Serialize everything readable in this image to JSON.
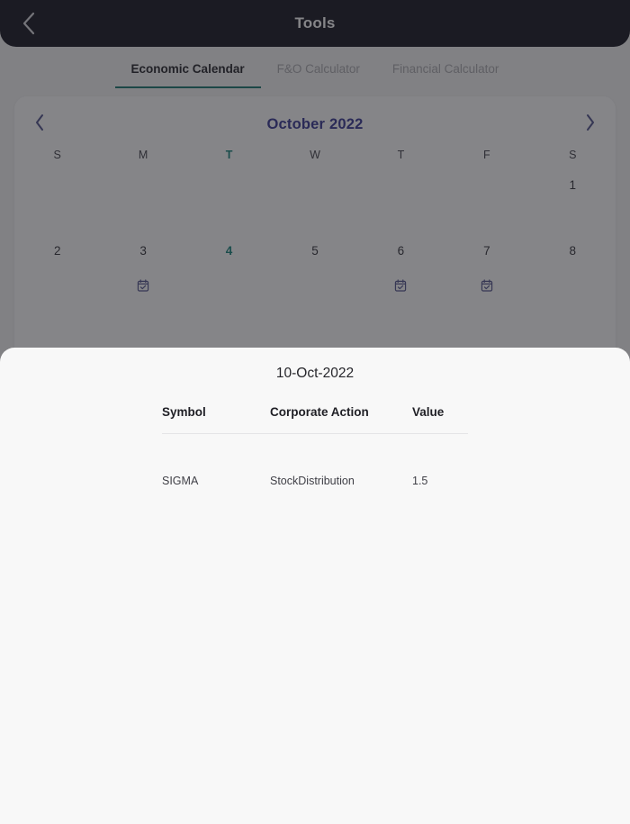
{
  "appbar": {
    "title": "Tools",
    "back_icon": "chevron-left-icon"
  },
  "tabs": [
    {
      "label": "Economic Calendar",
      "active": true
    },
    {
      "label": "F&O Calculator",
      "active": false
    },
    {
      "label": "Financial Calculator",
      "active": false
    }
  ],
  "calendar": {
    "month_title": "October 2022",
    "prev_icon": "chevron-left-icon",
    "next_icon": "chevron-right-icon",
    "weekday_headers": [
      {
        "label": "S",
        "today": false
      },
      {
        "label": "M",
        "today": false
      },
      {
        "label": "T",
        "today": true
      },
      {
        "label": "W",
        "today": false
      },
      {
        "label": "T",
        "today": false
      },
      {
        "label": "F",
        "today": false
      },
      {
        "label": "S",
        "today": false
      }
    ],
    "weeks": [
      [
        {
          "day": "",
          "today": false,
          "event": false
        },
        {
          "day": "",
          "today": false,
          "event": false
        },
        {
          "day": "",
          "today": false,
          "event": false
        },
        {
          "day": "",
          "today": false,
          "event": false
        },
        {
          "day": "",
          "today": false,
          "event": false
        },
        {
          "day": "",
          "today": false,
          "event": false
        },
        {
          "day": "1",
          "today": false,
          "event": false
        }
      ],
      [
        {
          "day": "2",
          "today": false,
          "event": false
        },
        {
          "day": "3",
          "today": false,
          "event": true
        },
        {
          "day": "4",
          "today": true,
          "event": false
        },
        {
          "day": "5",
          "today": false,
          "event": false
        },
        {
          "day": "6",
          "today": false,
          "event": true
        },
        {
          "day": "7",
          "today": false,
          "event": true
        },
        {
          "day": "8",
          "today": false,
          "event": false
        }
      ]
    ],
    "event_icon": "calendar-check-icon",
    "accent_color": "#0f8078",
    "title_color": "#30318f"
  },
  "sheet": {
    "title": "10-Oct-2022",
    "columns": [
      "Symbol",
      "Corporate Action",
      "Value"
    ],
    "rows": [
      {
        "symbol": "SIGMA",
        "action": "StockDistribution",
        "value": "1.5"
      }
    ]
  }
}
